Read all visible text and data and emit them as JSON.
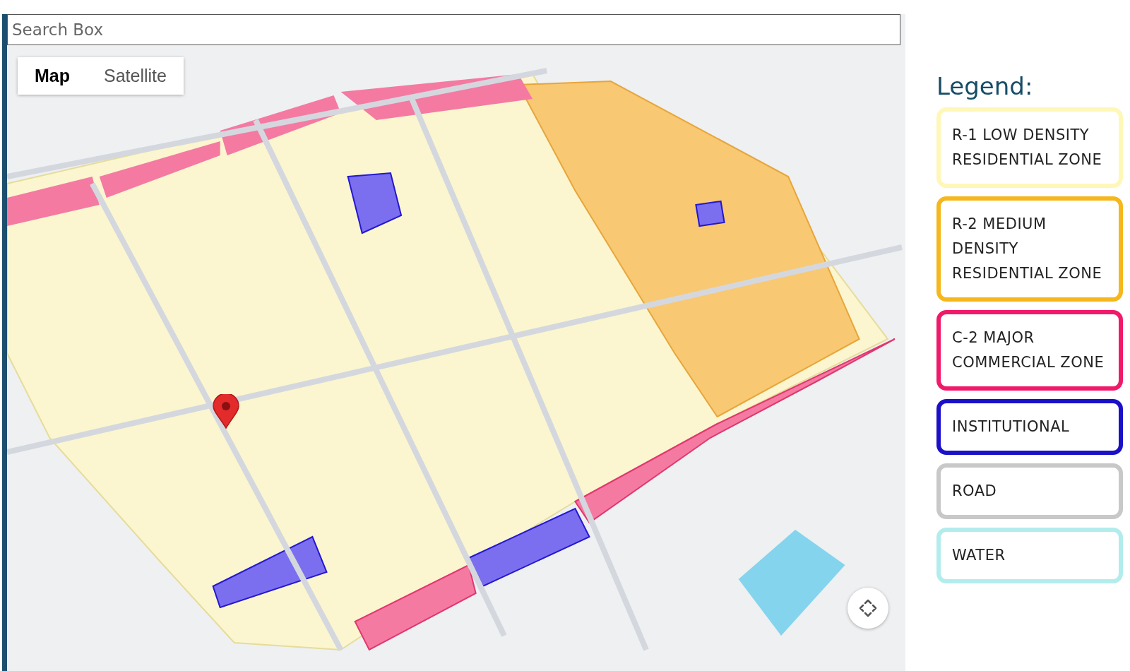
{
  "search": {
    "placeholder": "Search Box"
  },
  "map": {
    "kind": "picture",
    "map_types": [
      {
        "label": "Map",
        "selected": true
      },
      {
        "label": "Satellite",
        "selected": false
      }
    ]
  },
  "legend": {
    "title": "Legend:",
    "items": [
      {
        "label": "R-1 LOW DENSITY RESIDENTIAL ZONE",
        "color": "#fff7b8"
      },
      {
        "label": "R-2 MEDIUM DENSITY RESIDENTIAL ZONE",
        "color": "#f5b71c"
      },
      {
        "label": "C-2 MAJOR COMMERCIAL ZONE",
        "color": "#f0196a"
      },
      {
        "label": "INSTITUTIONAL",
        "color": "#1a10c8"
      },
      {
        "label": "ROAD",
        "color": "#c8c8c8"
      },
      {
        "label": "WATER",
        "color": "#b3ecec"
      }
    ]
  }
}
